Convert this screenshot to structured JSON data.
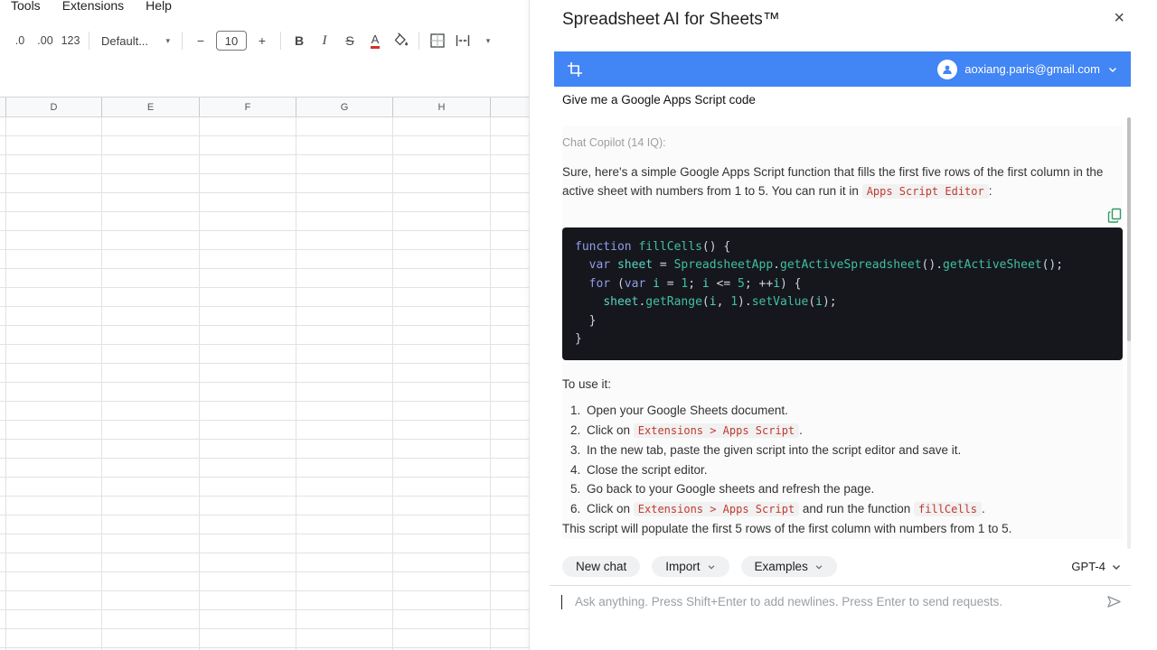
{
  "menubar": {
    "items": [
      "Tools",
      "Extensions",
      "Help"
    ]
  },
  "toolbar": {
    "decrease_decimal_label": ".0",
    "increase_decimal_label": ".00",
    "more_formats_label": "123",
    "font_label": "Default...",
    "decrease_font_label": "−",
    "font_size_value": "10",
    "increase_font_label": "+",
    "bold_label": "B",
    "italic_label": "I",
    "strikethrough_label": "S",
    "text_color_label": "A",
    "dropdown_glyph": "▾"
  },
  "sheet": {
    "columns": [
      "D",
      "E",
      "F",
      "G",
      "H"
    ]
  },
  "panel": {
    "title": "Spreadsheet AI for Sheets™",
    "close_label": "×",
    "account_email": "aoxiang.paris@gmail.com",
    "user_query": "Give me a Google Apps Script code",
    "copilot_label": "Chat Copilot (14 IQ):",
    "response_intro": [
      {
        "t": "Sure, here's a simple Google Apps Script function that fills the first five rows of the first column in the active sheet with numbers from 1 to 5. You can run it in "
      },
      {
        "code": "Apps Script Editor"
      },
      {
        "t": ":"
      }
    ],
    "code_lines": [
      [
        {
          "c": "kw",
          "t": "function "
        },
        {
          "c": "fn",
          "t": "fillCells"
        },
        {
          "c": "pl",
          "t": "() {"
        }
      ],
      [
        {
          "c": "pl",
          "t": "  "
        },
        {
          "c": "kw",
          "t": "var "
        },
        {
          "c": "id",
          "t": "sheet"
        },
        {
          "c": "pl",
          "t": " = "
        },
        {
          "c": "fn",
          "t": "SpreadsheetApp"
        },
        {
          "c": "pl",
          "t": "."
        },
        {
          "c": "fn",
          "t": "getActiveSpreadsheet"
        },
        {
          "c": "pl",
          "t": "()."
        },
        {
          "c": "fn",
          "t": "getActiveSheet"
        },
        {
          "c": "pl",
          "t": "();"
        }
      ],
      [
        {
          "c": "pl",
          "t": "  "
        },
        {
          "c": "kw",
          "t": "for"
        },
        {
          "c": "pl",
          "t": " ("
        },
        {
          "c": "kw",
          "t": "var "
        },
        {
          "c": "id",
          "t": "i"
        },
        {
          "c": "pl",
          "t": " = "
        },
        {
          "c": "num",
          "t": "1"
        },
        {
          "c": "pl",
          "t": "; "
        },
        {
          "c": "id",
          "t": "i"
        },
        {
          "c": "pl",
          "t": " <= "
        },
        {
          "c": "num",
          "t": "5"
        },
        {
          "c": "pl",
          "t": "; ++"
        },
        {
          "c": "id",
          "t": "i"
        },
        {
          "c": "pl",
          "t": ") {"
        }
      ],
      [
        {
          "c": "pl",
          "t": "    "
        },
        {
          "c": "id",
          "t": "sheet"
        },
        {
          "c": "pl",
          "t": "."
        },
        {
          "c": "fn",
          "t": "getRange"
        },
        {
          "c": "pl",
          "t": "("
        },
        {
          "c": "id",
          "t": "i"
        },
        {
          "c": "pl",
          "t": ", "
        },
        {
          "c": "num",
          "t": "1"
        },
        {
          "c": "pl",
          "t": ")."
        },
        {
          "c": "fn",
          "t": "setValue"
        },
        {
          "c": "pl",
          "t": "("
        },
        {
          "c": "id",
          "t": "i"
        },
        {
          "c": "pl",
          "t": ");"
        }
      ],
      [
        {
          "c": "pl",
          "t": "  }"
        }
      ],
      [
        {
          "c": "pl",
          "t": "}"
        }
      ]
    ],
    "to_use": "To use it:",
    "steps": [
      [
        {
          "t": "Open your Google Sheets document."
        }
      ],
      [
        {
          "t": "Click on "
        },
        {
          "code": "Extensions > Apps Script"
        },
        {
          "t": "."
        }
      ],
      [
        {
          "t": "In the new tab, paste the given script into the script editor and save it."
        }
      ],
      [
        {
          "t": "Close the script editor."
        }
      ],
      [
        {
          "t": "Go back to your Google sheets and refresh the page."
        }
      ],
      [
        {
          "t": "Click on "
        },
        {
          "code": "Extensions > Apps Script"
        },
        {
          "t": " and run the function "
        },
        {
          "code": "fillCells"
        },
        {
          "t": "."
        }
      ]
    ],
    "closing": "This script will populate the first 5 rows of the first column with numbers from 1 to 5.",
    "footer": {
      "new_chat": "New chat",
      "import": "Import",
      "examples": "Examples",
      "model": "GPT-4"
    },
    "input_placeholder": "Ask anything. Press Shift+Enter to add newlines. Press Enter to send requests."
  },
  "colors": {
    "accent_blue": "#4285f4",
    "code_background": "#16161d",
    "inline_code_red": "#c13a2e",
    "copy_icon_green": "#2e9e63",
    "text_color_underline_red": "#d93025"
  }
}
